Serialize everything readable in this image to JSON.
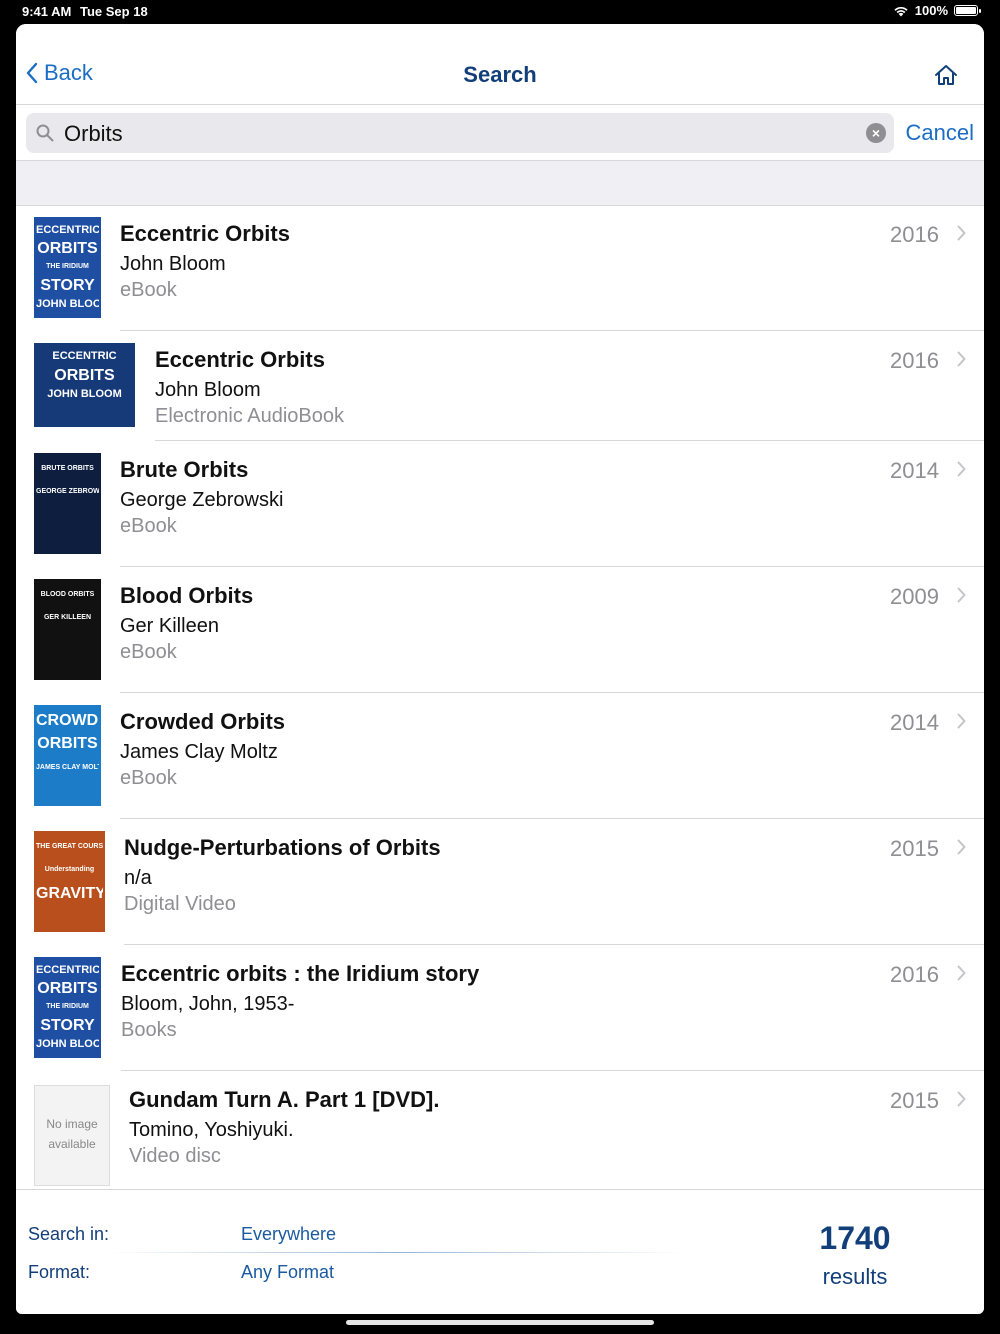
{
  "status": {
    "time": "9:41 AM",
    "date": "Tue Sep 18",
    "battery": "100%"
  },
  "nav": {
    "back_label": "Back",
    "title": "Search"
  },
  "search": {
    "value": "Orbits",
    "cancel_label": "Cancel"
  },
  "results": [
    {
      "title": "Eccentric Orbits",
      "author": "John Bloom",
      "format": "eBook",
      "year": "2016",
      "cover": {
        "lines": [
          "ECCENTRIC",
          "ORBITS",
          "THE IRIDIUM",
          "STORY",
          "JOHN BLOOM"
        ],
        "bg": "#1e4fa3"
      }
    },
    {
      "title": "Eccentric Orbits",
      "author": "John Bloom",
      "format": "Electronic AudioBook",
      "year": "2016",
      "cover": {
        "lines": [
          "ECCENTRIC",
          "ORBITS",
          "JOHN BLOOM"
        ],
        "bg": "#163a78"
      }
    },
    {
      "title": "Brute Orbits",
      "author": "George Zebrowski",
      "format": "eBook",
      "year": "2014",
      "cover": {
        "lines": [
          "BRUTE ORBITS",
          "GEORGE ZEBROWSKI"
        ],
        "bg": "#0e1e3e"
      }
    },
    {
      "title": "Blood Orbits",
      "author": "Ger Killeen",
      "format": "eBook",
      "year": "2009",
      "cover": {
        "lines": [
          "BLOOD ORBITS",
          "GER KILLEEN"
        ],
        "bg": "#111111"
      }
    },
    {
      "title": "Crowded Orbits",
      "author": "James Clay Moltz",
      "format": "eBook",
      "year": "2014",
      "cover": {
        "lines": [
          "CROWDED",
          "ORBITS",
          "JAMES CLAY MOLTZ"
        ],
        "bg": "#1d7cc7"
      }
    },
    {
      "title": "Nudge-Perturbations of Orbits",
      "author": "n/a",
      "format": "Digital Video",
      "year": "2015",
      "cover": {
        "lines": [
          "THE GREAT COURSES",
          "Understanding",
          "GRAVITY"
        ],
        "bg": "#b84f1c"
      }
    },
    {
      "title": "Eccentric orbits : the Iridium story",
      "author": "Bloom, John, 1953-",
      "format": "Books",
      "year": "2016",
      "cover": {
        "lines": [
          "ECCENTRIC",
          "ORBITS",
          "THE IRIDIUM",
          "STORY",
          "JOHN BLOOM"
        ],
        "bg": "#1e4fa3"
      }
    },
    {
      "title": "Gundam Turn A. Part 1 [DVD].",
      "author": "Tomino, Yoshiyuki.",
      "format": "Video disc",
      "year": "2015",
      "cover": {
        "lines": [
          "No image",
          "available"
        ],
        "bg": "#f3f3f3"
      }
    }
  ],
  "footer": {
    "search_in_label": "Search in:",
    "search_in_value": "Everywhere",
    "format_label": "Format:",
    "format_value": "Any Format",
    "count": "1740",
    "count_label": "results"
  }
}
